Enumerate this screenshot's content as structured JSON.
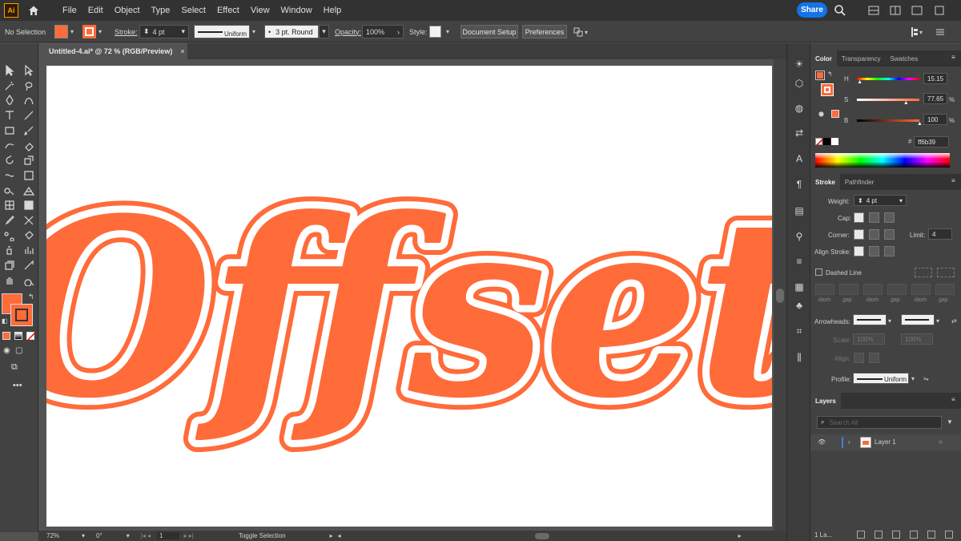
{
  "app": {
    "logo_text": "Ai"
  },
  "menu": [
    "File",
    "Edit",
    "Object",
    "Type",
    "Select",
    "Effect",
    "View",
    "Window",
    "Help"
  ],
  "share_label": "Share",
  "control_bar": {
    "selection": "No Selection",
    "stroke_label": "Stroke:",
    "stroke_weight": "4 pt",
    "profile": "Uniform",
    "brush": "3 pt. Round",
    "opacity_label": "Opacity:",
    "opacity": "100%",
    "style_label": "Style:",
    "document_setup": "Document Setup",
    "preferences": "Preferences"
  },
  "document_tab": {
    "title": "Untitled-4.ai* @ 72 % (RGB/Preview)",
    "close": "×"
  },
  "artwork_text": "Offset",
  "status_bar": {
    "zoom": "72%",
    "rotation": "0°",
    "artboard": "1",
    "toggle": "Toggle Selection"
  },
  "color_panel": {
    "tabs": [
      "Color",
      "Transparency",
      "Swatches"
    ],
    "h_label": "H",
    "h_value": "15.15",
    "h_fraction": 0.04,
    "s_label": "S",
    "s_value": "77.65",
    "s_fraction": 0.78,
    "b_label": "B",
    "b_value": "100",
    "b_fraction": 1.0,
    "pct": "%",
    "hex_prefix": "#",
    "hex": "ff6b39"
  },
  "stroke_panel": {
    "tabs": [
      "Stroke",
      "Pathfinder"
    ],
    "weight_label": "Weight:",
    "weight": "4 pt",
    "cap_label": "Cap:",
    "corner_label": "Corner:",
    "limit_label": "Limit:",
    "limit": "4",
    "align_label": "Align Stroke:",
    "dashed_label": "Dashed Line",
    "dash_labels": [
      "dash",
      "gap",
      "dash",
      "gap",
      "dash",
      "gap"
    ],
    "arrowheads_label": "Arrowheads:",
    "scale_label": "Scale:",
    "scale1": "100%",
    "scale2": "100%",
    "align2_label": "Align:",
    "profile_label": "Profile:",
    "profile": "Uniform"
  },
  "layers_panel": {
    "tab": "Layers",
    "search_placeholder": "Search All",
    "layer_name": "Layer 1",
    "footer": "1 La..."
  },
  "colors": {
    "fill": "#ff6b39",
    "accent": "#1473e6"
  }
}
